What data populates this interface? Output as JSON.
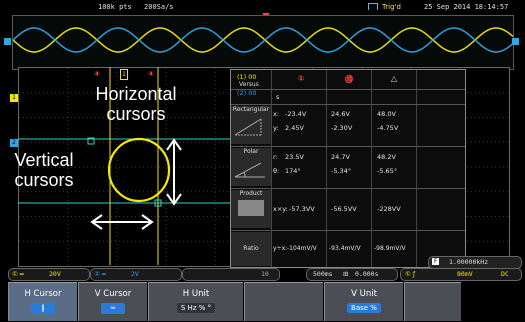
{
  "status_bar": {
    "record_length": "100k pts",
    "sample_rate": "200Sa/s",
    "trigger_status": "Trig'd",
    "datetime": "25 Sep 2014 18:14:57"
  },
  "channel_markers": {
    "ch1": "1",
    "ch2": "2",
    "ch3": "3"
  },
  "readout": {
    "mode_row_top": "(1) 00",
    "mode_label": "Versus",
    "mode_row_bottom": "(2) 00",
    "column_headers": [
      "①",
      "⓾",
      "△"
    ],
    "s_label": "s",
    "rows": [
      {
        "label": "Rectangular",
        "xy_label": "ΔY",
        "dx_label": "ΔX",
        "lines": [
          {
            "axis": "x:",
            "col1": "-23.4V",
            "col2": "24.6V",
            "col3": "48.0V"
          },
          {
            "axis": "y:",
            "col1": "2.45V",
            "col2": "-2.30V",
            "col3": "-4.75V"
          }
        ]
      },
      {
        "label": "Polar",
        "lines": [
          {
            "axis": "r:",
            "col1": "23.5V",
            "col2": "24.7V",
            "col3": "48.2V"
          },
          {
            "axis": "θ:",
            "col1": "174°",
            "col2": "-5.34°",
            "col3": "-5.65°"
          }
        ]
      },
      {
        "label": "Product",
        "lines": [
          {
            "axis": "x×y:",
            "col1": "-57.3VV",
            "col2": "-56.5VV",
            "col3": "-228VV"
          }
        ]
      },
      {
        "label": "Ratio",
        "lines": [
          {
            "axis": "y÷x:",
            "col1": "-104mV/V",
            "col2": "-93.4mV/V",
            "col3": "-98.9mV/V"
          }
        ]
      }
    ]
  },
  "annotations": {
    "horizontal": "Horizontal cursors",
    "vertical": "Vertical cursors"
  },
  "info_bar": {
    "ch1_scale": "20V",
    "ch2_scale": "2V",
    "ch3_scale": "10",
    "timebase": "500ms",
    "position": "0.000s",
    "freq_counter": "1.00000kHz",
    "trig_level": "80mV",
    "coupling": "DC"
  },
  "softkeys": [
    {
      "title": "H Cursor",
      "value": ""
    },
    {
      "title": "V Cursor",
      "value": ""
    },
    {
      "title": "H Unit",
      "value": "S Hz % °"
    },
    {
      "title": "",
      "value": ""
    },
    {
      "title": "V Unit",
      "value": "Base %"
    },
    {
      "title": "",
      "value": ""
    }
  ],
  "colors": {
    "ch1": "#f2e800",
    "ch2": "#2aa8e8",
    "cursor_h": "#38d0c8",
    "cursor_v": "#f0e200",
    "background": "#000000"
  }
}
